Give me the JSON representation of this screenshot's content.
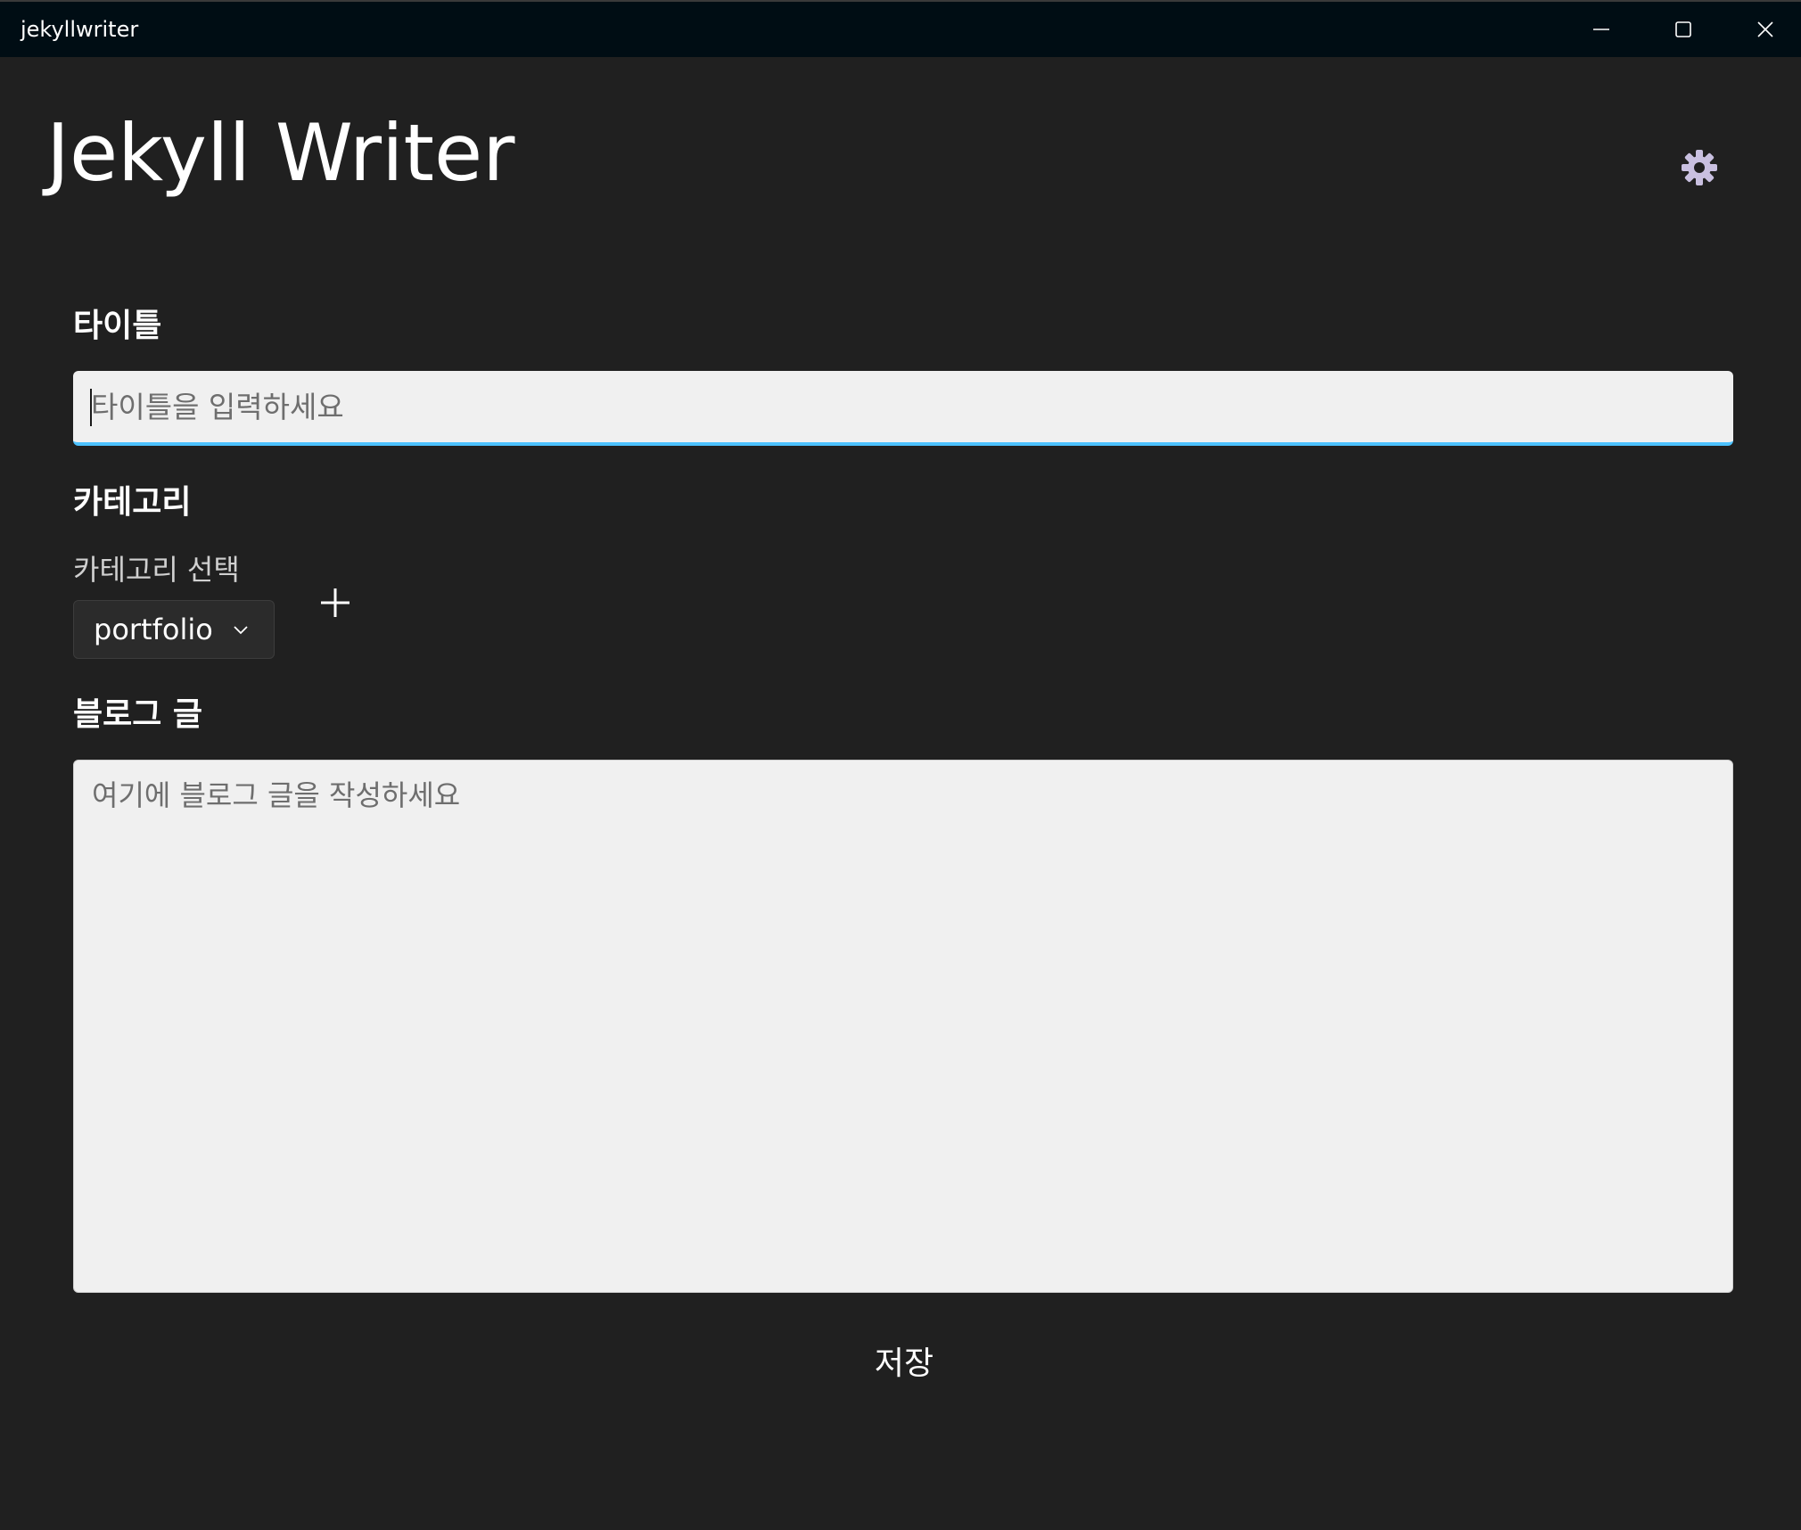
{
  "window": {
    "app_name": "jekyllwriter",
    "minimize_icon": "minimize-icon",
    "maximize_icon": "maximize-icon",
    "close_icon": "close-icon"
  },
  "header": {
    "title": "Jekyll Writer",
    "settings_icon": "gear-icon"
  },
  "form": {
    "title_label": "타이틀",
    "title_placeholder": "타이틀을 입력하세요",
    "title_value": "",
    "category_label": "카테고리",
    "category_hint": "카테고리 선택",
    "category_selected": "portfolio",
    "add_category_icon": "plus-icon",
    "post_label": "블로그 글",
    "post_placeholder": "여기에 블로그 글을 작성하세요",
    "post_value": "",
    "save_label": "저장"
  },
  "colors": {
    "background": "#202020",
    "titlebar": "#000d14",
    "input_background": "#f0f0f0",
    "focus_accent": "#4cc2ff",
    "gear": "#c9c0e0"
  }
}
